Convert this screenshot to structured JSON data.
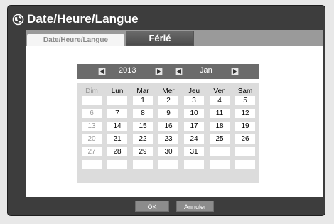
{
  "dialog": {
    "title": "Date/Heure/Langue",
    "icon": "globe-icon"
  },
  "tabs": [
    {
      "label": "Date/Heure/Langue",
      "active": false
    },
    {
      "label": "Férié",
      "active": true
    }
  ],
  "nav": {
    "year": "2013",
    "month": "Jan",
    "prev_icon": "arrow-left-icon",
    "next_icon": "arrow-right-icon"
  },
  "calendar": {
    "weekdays": [
      "Dim",
      "Lun",
      "Mar",
      "Mer",
      "Jeu",
      "Ven",
      "Sam"
    ],
    "weeks": [
      [
        "",
        "",
        "1",
        "2",
        "3",
        "4",
        "5"
      ],
      [
        "6",
        "7",
        "8",
        "9",
        "10",
        "11",
        "12"
      ],
      [
        "13",
        "14",
        "15",
        "16",
        "17",
        "18",
        "19"
      ],
      [
        "20",
        "21",
        "22",
        "23",
        "24",
        "25",
        "26"
      ],
      [
        "27",
        "28",
        "29",
        "30",
        "31",
        "",
        ""
      ],
      [
        "",
        "",
        "",
        "",
        "",
        "",
        ""
      ]
    ]
  },
  "buttons": {
    "ok": "OK",
    "cancel": "Annuler"
  }
}
